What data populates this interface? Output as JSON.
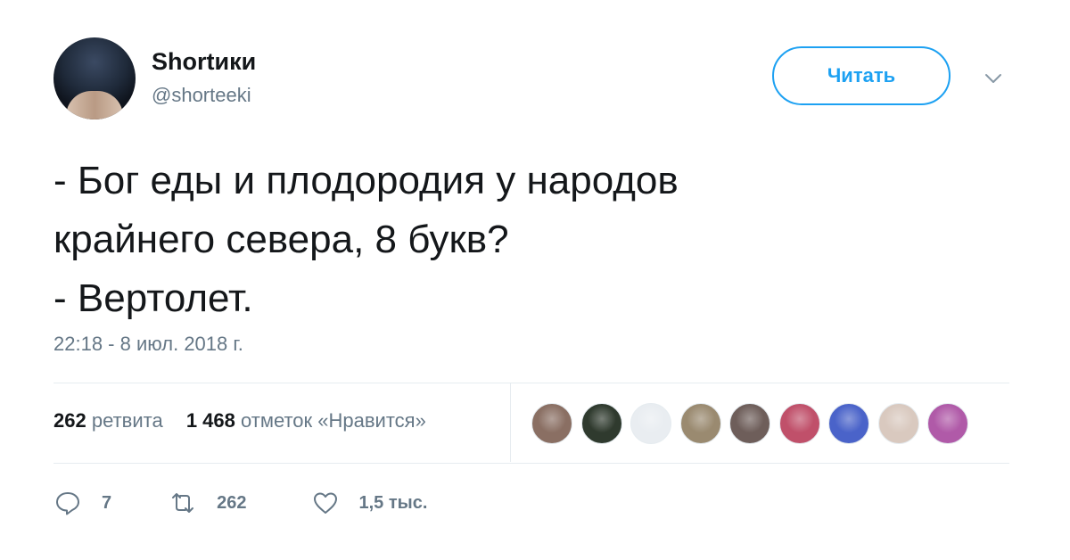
{
  "user": {
    "display_name": "Shortики",
    "handle": "@shorteeki"
  },
  "follow_button_label": "Читать",
  "tweet": {
    "lines": [
      "- Бог еды и плодородия у народов",
      "крайнего севера, 8 букв?",
      "- Вертолет."
    ],
    "timestamp": "22:18 - 8 июл. 2018 г."
  },
  "stats": {
    "retweets_count": "262",
    "retweets_label": "ретвита",
    "likes_count": "1 468",
    "likes_label": "отметок «Нравится»"
  },
  "likers": [
    {
      "color": "#8a6f63"
    },
    {
      "color": "#2f3a2e"
    },
    {
      "color": "#e9edf1"
    },
    {
      "color": "#9a8a70"
    },
    {
      "color": "#6e5e5a"
    },
    {
      "color": "#c0506a"
    },
    {
      "color": "#4a63c9"
    },
    {
      "color": "#d9c9bf"
    },
    {
      "color": "#b05aa8"
    }
  ],
  "actions": {
    "replies": "7",
    "retweets": "262",
    "likes": "1,5 тыс."
  },
  "colors": {
    "accent": "#1da1f2",
    "secondary_text": "#657786",
    "divider": "#e6ecf0"
  }
}
